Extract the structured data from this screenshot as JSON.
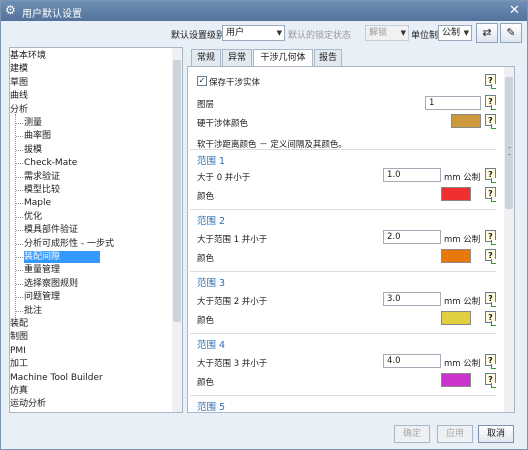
{
  "window": {
    "title": "用户默认设置",
    "close_glyph": "✕"
  },
  "toolbar": {
    "level_label": "默认设置级别",
    "level_value": "用户",
    "lock_label": "默认的锁定状态",
    "lock_value": "解锁",
    "unit_label": "单位制",
    "unit_value": "公制",
    "icon_buttons": [
      "import-export-icon",
      "manage-icon"
    ]
  },
  "tree": {
    "items": [
      {
        "label": "基本环境",
        "level": 0
      },
      {
        "label": "建模",
        "level": 0
      },
      {
        "label": "草图",
        "level": 0
      },
      {
        "label": "曲线",
        "level": 0
      },
      {
        "label": "分析",
        "level": 0
      },
      {
        "label": "测量",
        "level": 1
      },
      {
        "label": "曲率图",
        "level": 1
      },
      {
        "label": "拔模",
        "level": 1
      },
      {
        "label": "Check-Mate",
        "level": 1
      },
      {
        "label": "需求验证",
        "level": 1
      },
      {
        "label": "模型比较",
        "level": 1
      },
      {
        "label": "Maple",
        "level": 1
      },
      {
        "label": "优化",
        "level": 1
      },
      {
        "label": "模具部件验证",
        "level": 1
      },
      {
        "label": "分析可成形性 - 一步式",
        "level": 1
      },
      {
        "label": "装配间隙",
        "level": 1,
        "selected": true
      },
      {
        "label": "重量管理",
        "level": 1
      },
      {
        "label": "选择察图规则",
        "level": 1
      },
      {
        "label": "问题管理",
        "level": 1
      },
      {
        "label": "批注",
        "level": 1
      },
      {
        "label": "装配",
        "level": 0
      },
      {
        "label": "制图",
        "level": 0
      },
      {
        "label": "PMI",
        "level": 0
      },
      {
        "label": "加工",
        "level": 0
      },
      {
        "label": "Machine Tool Builder",
        "level": 0
      },
      {
        "label": "仿真",
        "level": 0
      },
      {
        "label": "运动分析",
        "level": 0
      }
    ]
  },
  "tabs": [
    "常规",
    "异常",
    "干涉几何体",
    "报告"
  ],
  "active_tab": "干涉几何体",
  "panel": {
    "save_checkbox_label": "保存干涉实体",
    "save_checked": true,
    "layer_label": "图层",
    "layer_value": "1",
    "hard_color_label": "硬干涉体颜色",
    "hard_color": "#cc9a3a",
    "soft_heading": "软干涉距离颜色 － 定义间隔及其颜色。",
    "unit": "mm 公制",
    "color_label": "颜色",
    "help_glyph": "?",
    "ranges": [
      {
        "title": "范围 1",
        "label": "大于 0 并小于",
        "value": "1.0",
        "color": "#f03030"
      },
      {
        "title": "范围 2",
        "label": "大于范围 1 并小于",
        "value": "2.0",
        "color": "#e8780a"
      },
      {
        "title": "范围 3",
        "label": "大于范围 2 并小于",
        "value": "3.0",
        "color": "#e0d040"
      },
      {
        "title": "范围 4",
        "label": "大于范围 3 并小于",
        "value": "4.0",
        "color": "#cc33cc"
      },
      {
        "title": "范围 5"
      }
    ]
  },
  "buttons": {
    "ok": "确定",
    "apply": "应用",
    "cancel": "取消"
  }
}
